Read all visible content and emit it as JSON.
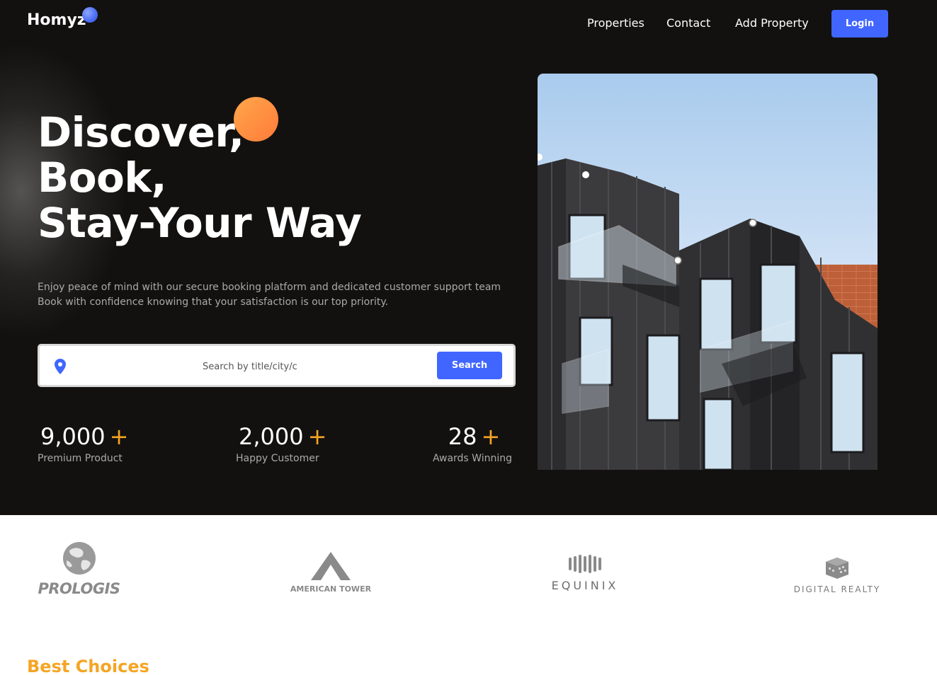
{
  "nav": {
    "logo": "Homyz",
    "links": [
      "Properties",
      "Contact",
      "Add Property"
    ],
    "login_label": "Login"
  },
  "hero": {
    "headline": [
      "Discover,",
      "Book,",
      "Stay-Your Way"
    ],
    "subtext": [
      "Enjoy peace of mind with our secure booking platform and dedicated customer support team",
      "Book with confidence knowing that your satisfaction is our top priority."
    ],
    "search": {
      "placeholder": "Search by title/city/c",
      "button_label": "Search"
    },
    "stats": [
      {
        "value": "9,000",
        "plus": "+",
        "label": "Premium Product"
      },
      {
        "value": "2,000",
        "plus": "+",
        "label": "Happy Customer"
      },
      {
        "value": "28",
        "plus": "+",
        "label": "Awards Winning"
      }
    ]
  },
  "partners": [
    {
      "name": "PROLOGIS",
      "icon": "globe-icon"
    },
    {
      "name": "AMERICAN TOWER",
      "icon": "tower-icon"
    },
    {
      "name": "EQUINIX",
      "icon": "equinix-icon"
    },
    {
      "name": "DIGITAL REALTY",
      "icon": "cube-icon"
    }
  ],
  "section": {
    "title": "Best Choices"
  },
  "colors": {
    "accent_blue": "#4066ff",
    "accent_orange": "#f5a524",
    "hero_bg": "#131110"
  }
}
